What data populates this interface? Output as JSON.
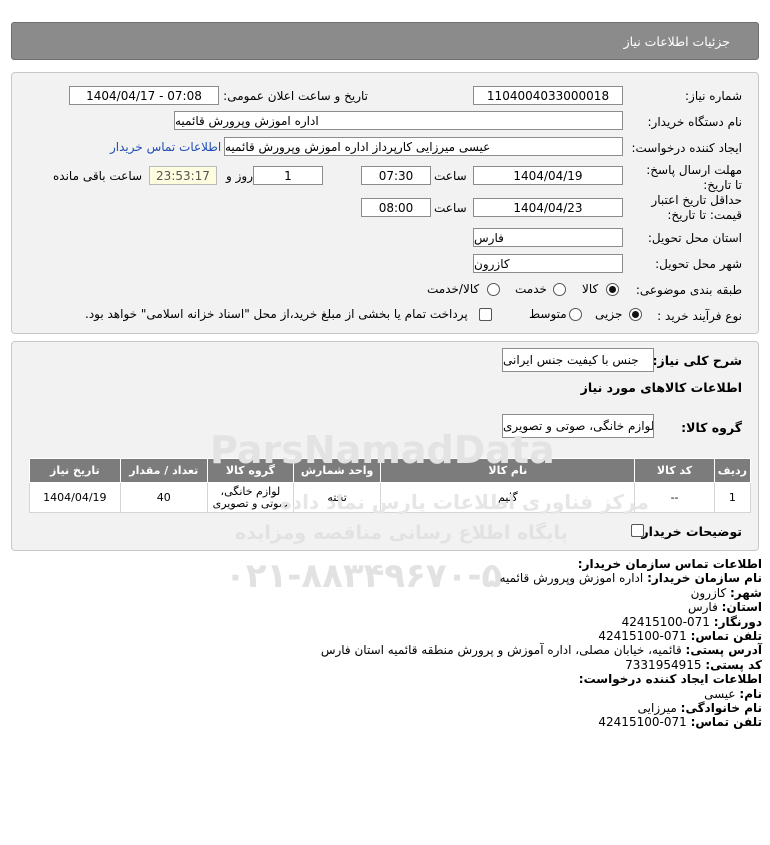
{
  "header": {
    "title": "جزئیات اطلاعات نیاز"
  },
  "form": {
    "need_number_label": "شماره نیاز:",
    "need_number": "1104004033000018",
    "announce_label": "تاریخ و ساعت اعلان عمومی:",
    "announce_value": "1404/04/17 - 07:08",
    "buyer_label": "نام دستگاه خریدار:",
    "buyer_value": "اداره اموزش وپرورش قائمیه",
    "creator_label": "ایجاد کننده درخواست:",
    "creator_value": "عیسی میرزایی کارپرداز اداره اموزش وپرورش قائمیه",
    "contact_link": "اطلاعات تماس خریدار",
    "deadline_label": "مهلت ارسال پاسخ: تا تاریخ:",
    "deadline_date": "1404/04/19",
    "time_label": "ساعت",
    "deadline_time": "07:30",
    "days_value": "1",
    "days_label": "روز و",
    "remaining_value": "23:53:17",
    "remaining_label": "ساعت باقی مانده",
    "validity_label": "حداقل تاریخ اعتبار قیمت: تا تاریخ:",
    "validity_date": "1404/04/23",
    "validity_time": "08:00",
    "province_label": "استان محل تحویل:",
    "province_value": "فارس",
    "city_label": "شهر محل تحویل:",
    "city_value": "کازرون",
    "category_label": "طبقه بندی موضوعی:",
    "category_options": [
      "کالا",
      "خدمت",
      "کالا/خدمت"
    ],
    "category_selected": "کالا",
    "process_label": "نوع فرآیند خرید :",
    "process_options": [
      "جزیی",
      "متوسط"
    ],
    "process_selected": "جزیی",
    "payment_note": "پرداخت تمام یا بخشی از مبلغ خرید،از محل \"اسناد خزانه اسلامی\" خواهد بود."
  },
  "summary": {
    "general_label": "شرح کلی نیاز:",
    "general_value": "جنس با کیفیت جنس ایرانی",
    "goods_info_title": "اطلاعات کالاهای مورد نیاز",
    "group_label": "گروه کالا:",
    "group_value": "لوازم خانگی، صوتی و تصویری"
  },
  "table": {
    "headers": [
      "ردیف",
      "کد کالا",
      "نام کالا",
      "واحد شمارش",
      "گروه کالا",
      "تعداد / مقدار",
      "تاریخ نیاز"
    ],
    "rows": [
      [
        "1",
        "--",
        "گلیم",
        "تخته",
        "لوازم خانگی، صوتی و تصویری",
        "40",
        "1404/04/19"
      ]
    ]
  },
  "buyer_notes_label": "توضیحات خریدار:",
  "contact": {
    "title": "اطلاعات تماس سازمان خریدار:",
    "org_label": "نام سازمان خریدار:",
    "org_value": "اداره اموزش وپرورش قائمیه",
    "city_label": "شهر:",
    "city_value": "کازرون",
    "province_label": "استان:",
    "province_value": "فارس",
    "fax_label": "دورنگار:",
    "fax_value": "071-42415100",
    "phone_label": "تلفن تماس:",
    "phone_value": "071-42415100",
    "address_label": "آدرس پستی:",
    "address_value": "قائمیه، خیابان مصلی، اداره آموزش و پرورش منطقه قائمیه استان فارس",
    "postal_label": "کد پستی:",
    "postal_value": "7331954915",
    "creator_title": "اطلاعات ایجاد کننده درخواست:",
    "first_name_label": "نام:",
    "first_name_value": "عیسی",
    "last_name_label": "نام خانوادگی:",
    "last_name_value": "میرزایی",
    "creator_phone_label": "تلفن تماس:",
    "creator_phone_value": "071-42415100"
  },
  "watermark": {
    "brand": "ParsNamadData",
    "line1": "مرکز فناوری اطلاعات پارس نماد داده",
    "line2": "پایگاه اطلاع رسانی مناقصه ومزایده",
    "phone": "۰۲۱-۸۸۳۴۹۶۷۰-۵"
  }
}
